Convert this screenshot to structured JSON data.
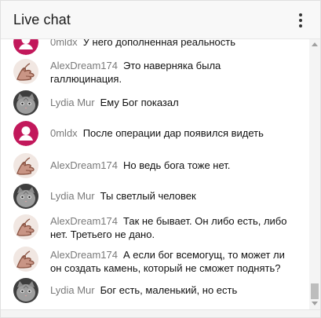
{
  "header": {
    "title": "Live chat",
    "menu_icon": "more-vertical-icon"
  },
  "avatars": {
    "0mldx": {
      "icon": "default-user-icon",
      "color": "#c2185b"
    },
    "AlexDream174": {
      "icon": "hand-drawing-icon",
      "color": "#a06a55"
    },
    "Lydia Mur": {
      "icon": "cat-photo-icon",
      "color": "#5a5a5a"
    }
  },
  "messages": [
    {
      "author": "0mldx",
      "text": "У него дополненная реальность"
    },
    {
      "author": "AlexDream174",
      "text": "Это наверняка была галлюцинация."
    },
    {
      "author": "Lydia Mur",
      "text": "Ему Бог показал"
    },
    {
      "author": "0mldx",
      "text": "После операции дар появился видеть"
    },
    {
      "author": "AlexDream174",
      "text": "Но ведь бога тоже нет."
    },
    {
      "author": "Lydia Mur",
      "text": "Ты светлый человек"
    },
    {
      "author": "AlexDream174",
      "text": "Так не бывает. Он либо есть, либо нет. Третьего не дано."
    },
    {
      "author": "AlexDream174",
      "text": "А если бог всемогущ, то может ли он создать камень, который не сможет поднять?"
    },
    {
      "author": "Lydia Mur",
      "text": "Бог есть, маленький, но есть"
    }
  ]
}
